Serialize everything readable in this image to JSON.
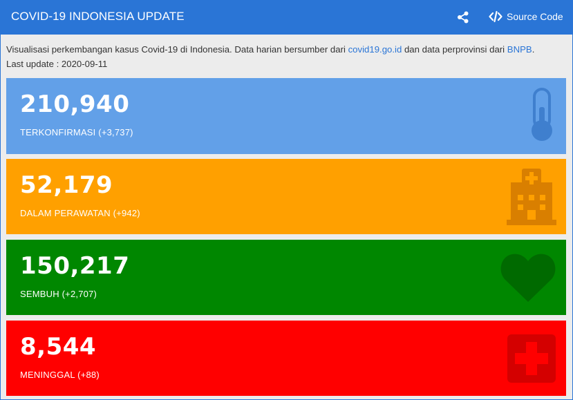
{
  "header": {
    "title": "COVID-19 INDONESIA UPDATE",
    "source_label": "Source Code"
  },
  "description": {
    "text_before": "Visualisasi perkembangan kasus Covid-19 di Indonesia. Data harian bersumber dari ",
    "link1": "covid19.go.id",
    "text_middle": " dan data perprovinsi dari ",
    "link2": "BNPB",
    "text_after": ".",
    "last_update": "Last update : 2020-09-11"
  },
  "cards": [
    {
      "value": "210,940",
      "label": "TERKONFIRMASI (+3,737)",
      "icon": "thermometer-icon",
      "color": "#62a0e8"
    },
    {
      "value": "52,179",
      "label": "DALAM PERAWATAN (+942)",
      "icon": "hospital-icon",
      "color": "#ffa000"
    },
    {
      "value": "150,217",
      "label": "SEMBUH (+2,707)",
      "icon": "heart-icon",
      "color": "#008700"
    },
    {
      "value": "8,544",
      "label": "MENINGGAL (+88)",
      "icon": "medical-cross-icon",
      "color": "#ff0000"
    }
  ]
}
